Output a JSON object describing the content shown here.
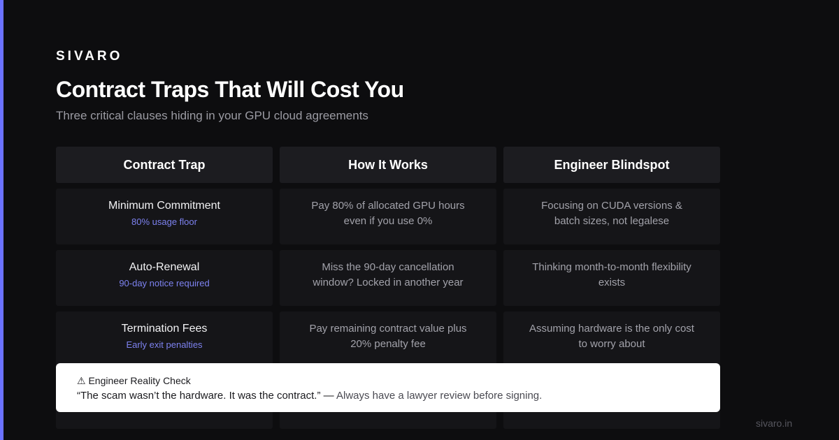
{
  "brand": "SIVARO",
  "title": "Contract Traps That Will Cost You",
  "subtitle": "Three critical clauses hiding in your GPU cloud agreements",
  "table": {
    "headers": [
      "Contract Trap",
      "How It Works",
      "Engineer Blindspot"
    ],
    "rows": [
      {
        "trap": "Minimum Commitment",
        "tag": "80% usage floor",
        "how": "Pay 80% of allocated GPU hours even if you use 0%",
        "blindspot": "Focusing on CUDA versions & batch sizes, not legalese"
      },
      {
        "trap": "Auto-Renewal",
        "tag": "90-day notice required",
        "how": "Miss the 90-day cancellation window? Locked in another year",
        "blindspot": "Thinking month-to-month flexibility exists"
      },
      {
        "trap": "Termination Fees",
        "tag": "Early exit penalties",
        "how": "Pay remaining contract value plus 20% penalty fee",
        "blindspot": "Assuming hardware is the only cost to worry about"
      }
    ]
  },
  "callout": {
    "icon": "warning-icon",
    "icon_glyph": "⚠",
    "heading": "Engineer Reality Check",
    "quote": "“The scam wasn’t the hardware. It was the contract.”",
    "dash": " — ",
    "note": "Always have a lawyer review before signing."
  },
  "footer": {
    "url": "sivaro.in"
  },
  "colors": {
    "background": "#0d0d0f",
    "accent": "#6b72ff",
    "tag": "#7d82f0",
    "header_cell": "#1c1c20",
    "cell": "#151518",
    "callout_bg": "#ffffff"
  }
}
